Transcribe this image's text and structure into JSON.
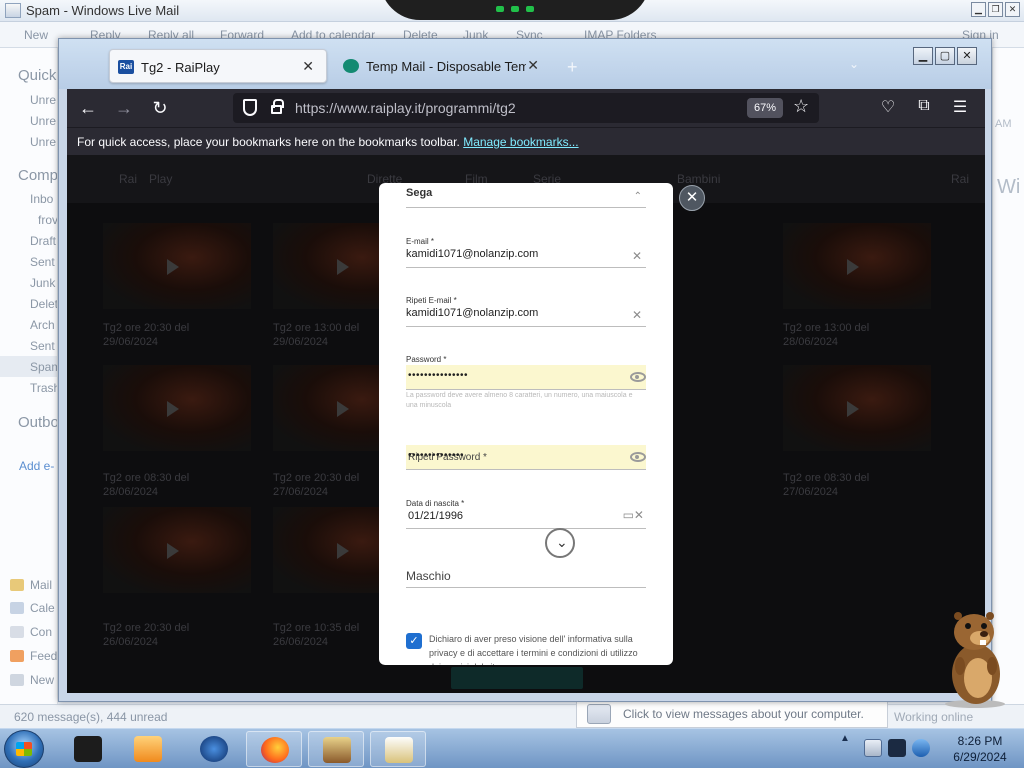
{
  "wlm": {
    "title": "Spam - Windows Live Mail",
    "ribbon": [
      "New",
      "Reply",
      "Reply all",
      "Forward",
      "Add to calendar",
      "Delete",
      "Junk",
      "Sync",
      "IMAP Folders",
      "Sign in"
    ],
    "quick_header": "Quick",
    "quick_items": [
      "Unre",
      "Unre",
      "Unre"
    ],
    "comp_header": "Comp",
    "folders": [
      "Inbo",
      "frov",
      "Draft",
      "Sent",
      "Junk",
      "Delet",
      "Arch",
      "Sent",
      "Spam",
      "Trash"
    ],
    "outbox": "Outbo",
    "add_email": "Add e-",
    "nav_items": [
      "Mail",
      "Cale",
      "Con",
      "Feed",
      "New"
    ],
    "status_count": "620 message(s), 444 unread",
    "online_status": "Working online",
    "right_fragments": [
      "AM",
      "Wi"
    ]
  },
  "notification": {
    "text": "Click to view messages about your computer."
  },
  "firefox": {
    "tabs": [
      {
        "title": "Tg2 - RaiPlay",
        "favicon": "Rai",
        "color": "#1a4fa0"
      },
      {
        "title": "Temp Mail - Disposable Tempo",
        "favicon": "",
        "color": "#138a72"
      }
    ],
    "url": "https://www.raiplay.it/programmi/tg2",
    "zoom": "67%",
    "bookmark_msg": "For quick access, place your bookmarks here on the bookmarks toolbar.",
    "bookmark_link": "Manage bookmarks..."
  },
  "page": {
    "header_items": [
      "Rai",
      "Play",
      "Dirette",
      "Film",
      "Serie",
      "Bambini",
      "Rai"
    ],
    "captions": [
      [
        "Tg2 ore 20:30 del",
        "29/06/2024"
      ],
      [
        "Tg2 ore 13:00 del",
        "29/06/2024"
      ],
      [
        "Tg2 ore 13:00 del",
        "28/06/2024"
      ],
      [
        "Tg2 ore 08:30 del",
        "28/06/2024"
      ],
      [
        "Tg2 ore 20:30 del",
        "27/06/2024"
      ],
      [
        "Tg2 ore 08:30 del",
        "27/06/2024"
      ],
      [
        "Tg2 ore 20:30 del",
        "26/06/2024"
      ],
      [
        "Tg2 ore 10:35 del",
        "26/06/2024"
      ]
    ]
  },
  "modal": {
    "top_value": "Sega",
    "email_label": "E-mail *",
    "email_value": "kamidi1071@nolanzip.com",
    "repeat_email_label": "Ripeti E-mail *",
    "repeat_email_value": "kamidi1071@nolanzip.com",
    "password_label": "Password *",
    "password_value": "•••••••••••••••",
    "password_hint": "La password deve avere almeno 8 caratteri, un numero, una maiuscola e una minuscola",
    "repeat_password_placeholder": "Ripeti Password *",
    "repeat_password_value": "••••••••••••••",
    "birth_label": "Data di nascita *",
    "birth_value": "01/21/1996",
    "gender_value": "Maschio",
    "consent_text": "Dichiaro di aver preso visione dell' informativa sulla privacy e di accettare i termini e condizioni di utilizzo dei servizi del sito"
  },
  "taskbar": {
    "time": "8:26 PM",
    "date": "6/29/2024"
  },
  "colors": {
    "accent": "#1f6fd0",
    "autofill": "#fbf7cf",
    "firefox_toolbar": "#2b2a33"
  }
}
